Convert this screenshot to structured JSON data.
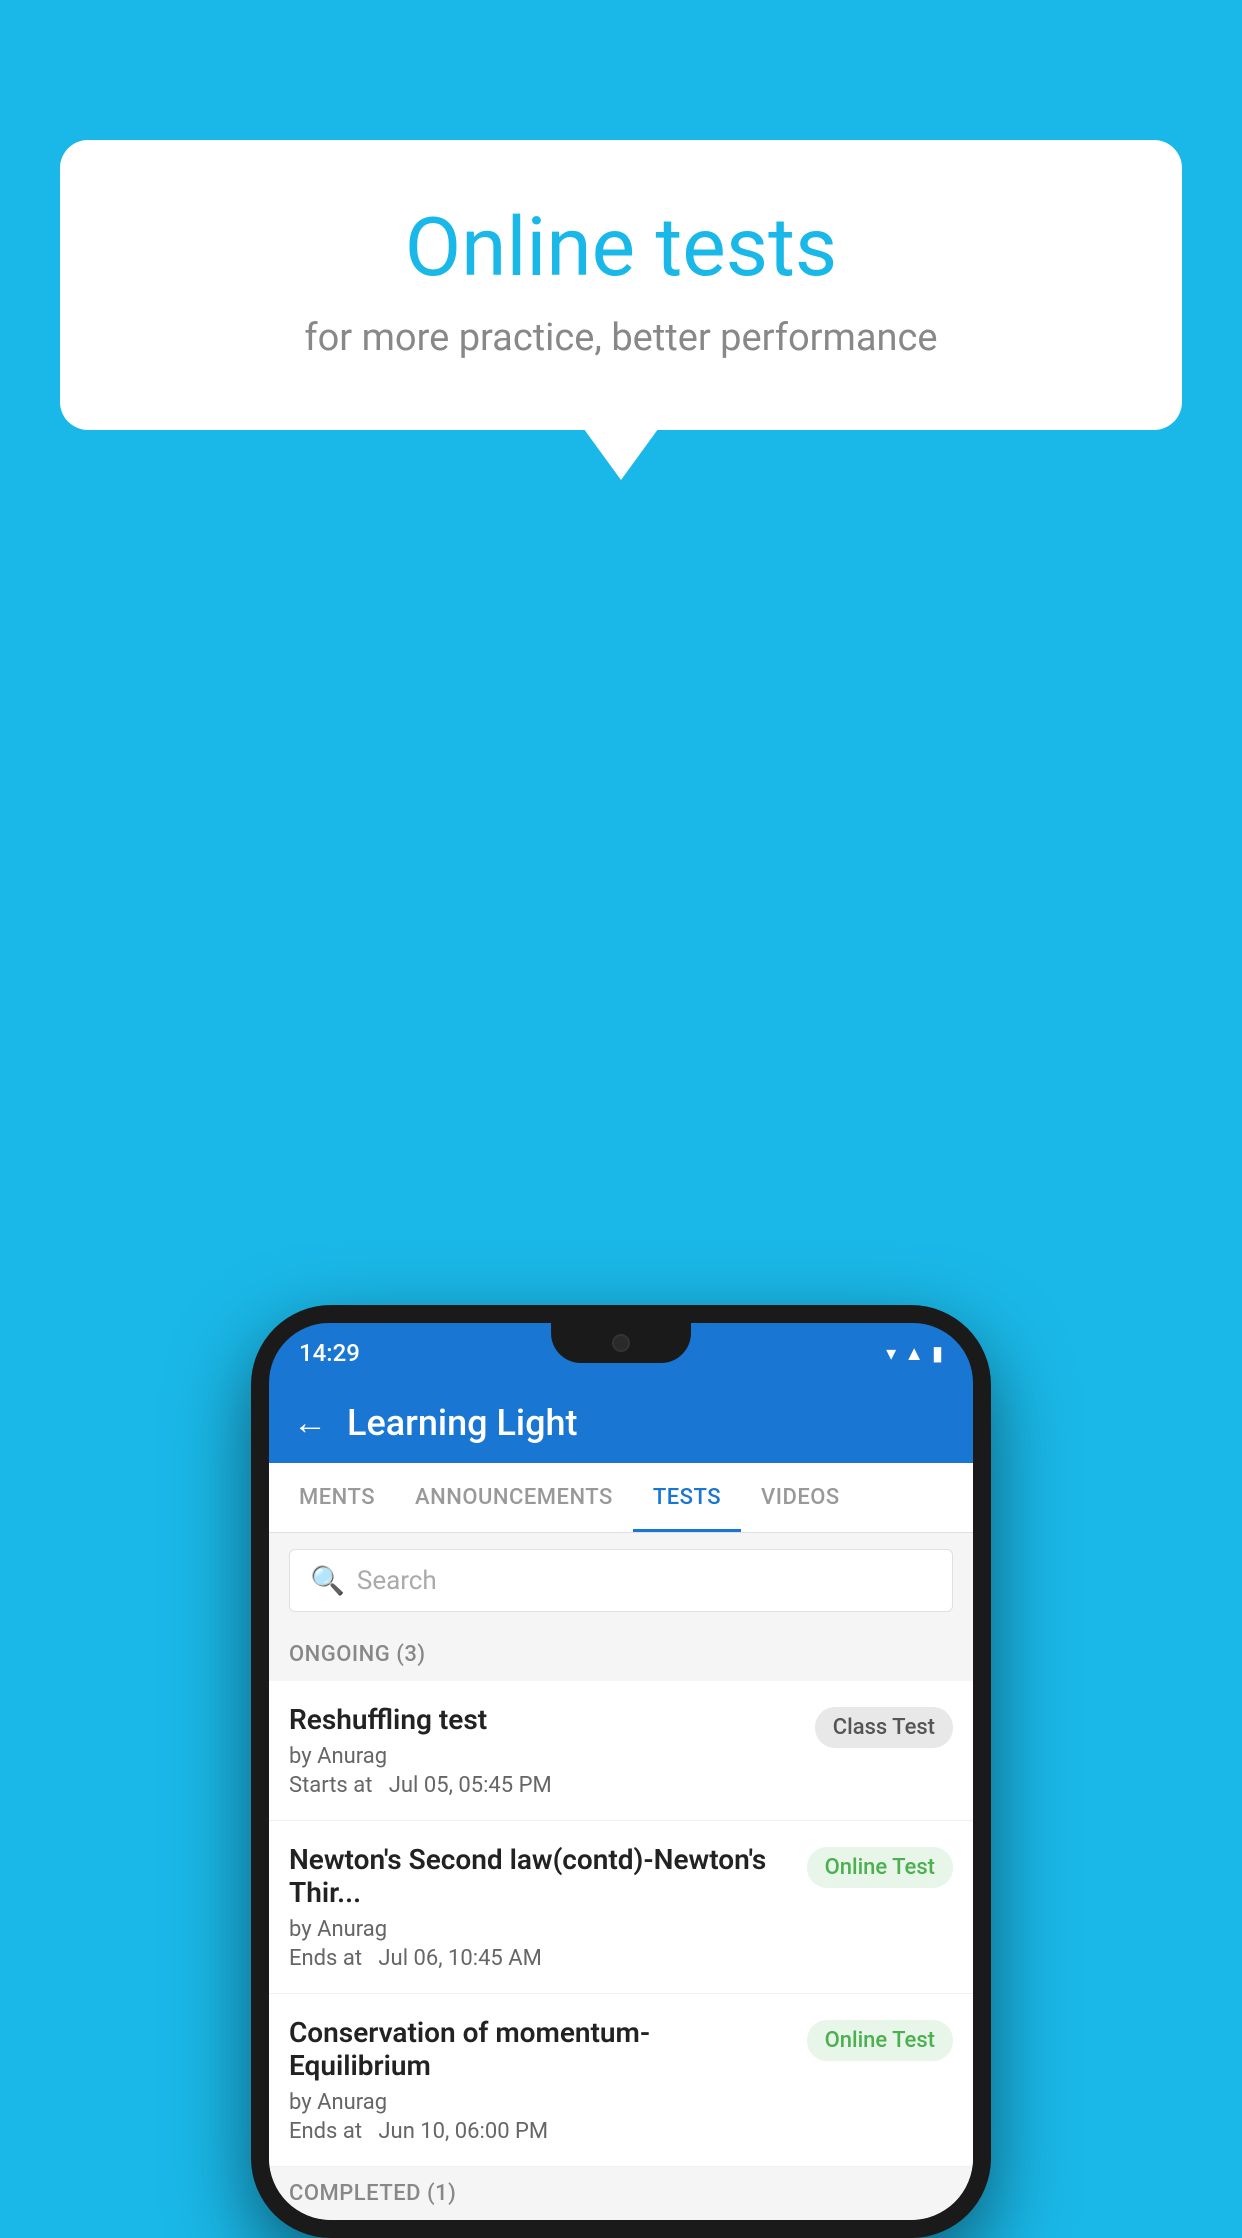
{
  "background_color": "#1ab8e8",
  "speech_bubble": {
    "title": "Online tests",
    "subtitle": "for more practice, better performance"
  },
  "phone": {
    "status_bar": {
      "time": "14:29",
      "icons": [
        "wifi",
        "signal",
        "battery"
      ]
    },
    "app_bar": {
      "back_label": "←",
      "title": "Learning Light"
    },
    "tabs": [
      {
        "label": "MENTS",
        "active": false
      },
      {
        "label": "ANNOUNCEMENTS",
        "active": false
      },
      {
        "label": "TESTS",
        "active": true
      },
      {
        "label": "VIDEOS",
        "active": false
      }
    ],
    "search": {
      "placeholder": "Search"
    },
    "sections": [
      {
        "label": "ONGOING (3)",
        "items": [
          {
            "name": "Reshuffling test",
            "by": "by Anurag",
            "time_label": "Starts at",
            "time": "Jul 05, 05:45 PM",
            "badge": "Class Test",
            "badge_type": "class"
          },
          {
            "name": "Newton's Second law(contd)-Newton's Thir...",
            "by": "by Anurag",
            "time_label": "Ends at",
            "time": "Jul 06, 10:45 AM",
            "badge": "Online Test",
            "badge_type": "online"
          },
          {
            "name": "Conservation of momentum-Equilibrium",
            "by": "by Anurag",
            "time_label": "Ends at",
            "time": "Jun 10, 06:00 PM",
            "badge": "Online Test",
            "badge_type": "online"
          }
        ]
      }
    ],
    "completed_label": "COMPLETED (1)"
  }
}
